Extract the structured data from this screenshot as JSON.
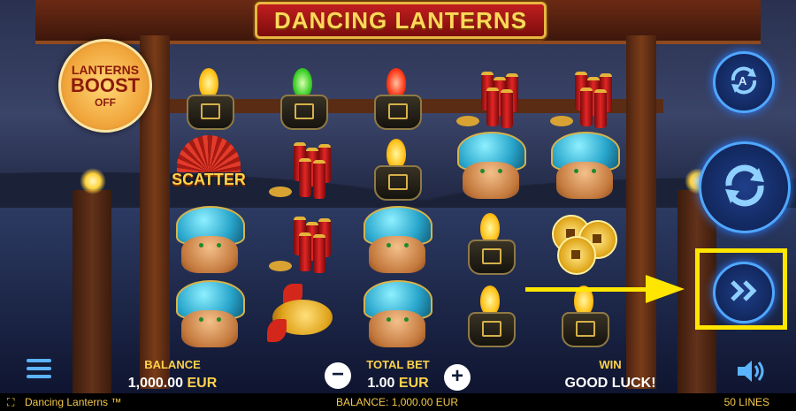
{
  "game": {
    "title": "DANCING LANTERNS",
    "boost": {
      "line1": "LANTERNS",
      "line2": "BOOST",
      "line3": "OFF"
    },
    "scatter_label": "SCATTER",
    "reels": [
      [
        "lantern-yellow",
        "scatter-fan",
        "turtle",
        "turtle"
      ],
      [
        "lantern-green",
        "firecracker",
        "firecracker",
        "koi"
      ],
      [
        "lantern-red",
        "lantern-yellow",
        "turtle",
        "turtle"
      ],
      [
        "firecracker",
        "turtle",
        "lantern-yellow",
        "lantern-yellow"
      ],
      [
        "firecracker",
        "turtle",
        "coins",
        "lantern-yellow"
      ]
    ],
    "colors": {
      "highlight": "#ffe600",
      "accent": "#ffd24a",
      "control_glow": "#4fa7ff"
    }
  },
  "controls": {
    "autoplay_icon": "autoplay-icon",
    "spin_icon": "spin-icon",
    "turbo_icon": "fast-forward-icon",
    "menu_icon": "menu-icon",
    "sound_icon": "speaker-icon"
  },
  "hud": {
    "balance_label": "BALANCE",
    "balance_value": "1,000.00",
    "currency": "EUR",
    "total_bet_label": "TOTAL BET",
    "total_bet_value": "1.00",
    "minus": "−",
    "plus": "+",
    "win_label": "WIN",
    "win_value": "GOOD LUCK!",
    "lines": "50 LINES"
  },
  "status": {
    "game_name": "Dancing Lanterns ™",
    "balance": "BALANCE: 1,000.00 EUR"
  }
}
